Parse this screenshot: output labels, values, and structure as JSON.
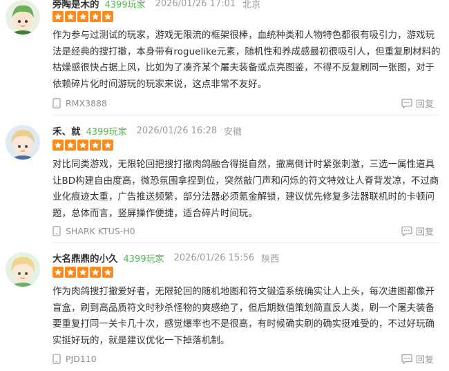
{
  "reviews": [
    {
      "user": "旁陶是木的",
      "badge": "4399玩家",
      "time": "2026/01/26 17:01",
      "location": "北京",
      "rating": 5,
      "content": "作为参与过测试的玩家，游戏无限流的框架很棒，血统种类和人物特色都很有吸引力，游戏玩法是经典的搜打撤，本身带有roguelike元素，随机性和养成感最初很吸引人，但重复刷材料的枯燥感很快占据上风，比如为了凑齐某个屠夫装备或点亮图鉴，不得不反复刷同一张图，对于依赖碎片化时间游玩的玩家来说，这点非常不友好。",
      "device": "RMX3888",
      "reply_label": "回复"
    },
    {
      "user": "禾、就",
      "badge": "4399玩家",
      "time": "2026/01/26 16:28",
      "location": "安徽",
      "rating": 5,
      "content": "对比同类游戏，无限轮回把搜打撤肉鸽融合得挺自然，撤离倒计时紧张刺激，三选一属性道具让BD构建自由度高，微恐氛围拿捏到位，突然敲门声和闪烁的符文特效让人脊背发凉，不过商业化痕迹太重，广告推送频繁，部分法器必须氪金解锁，建议优先修复多法器联机时的卡顿问题，总体而言，竖屏操作便捷，适合碎片时间玩。",
      "device": "SHARK KTUS-H0",
      "reply_label": "回复"
    },
    {
      "user": "大名鼎鼎的小久",
      "badge": "4399玩家",
      "time": "2026/01/26 15:56",
      "location": "陕西",
      "rating": 5,
      "content": "作为肉鸽搜打撤爱好者，无限轮回的随机地图和符文锻造系统确实让人上头，每次进图都像开盲盒，刷到高品质符文时秒杀怪物的爽感绝了，但后期数值策划简直反人类，刷一个屠夫装备要重复打同一关卡几十次，感觉爆率也不是很高，有时候确实刷的确实挺难受的，不过好玩确实挺好玩的，就是建议优化一下掉落机制。",
      "device": "PJD110",
      "reply_label": "回复"
    }
  ],
  "colors": {
    "badge": "#54b64e",
    "star": "#ff8a1c",
    "muted": "#9b9b9b"
  }
}
